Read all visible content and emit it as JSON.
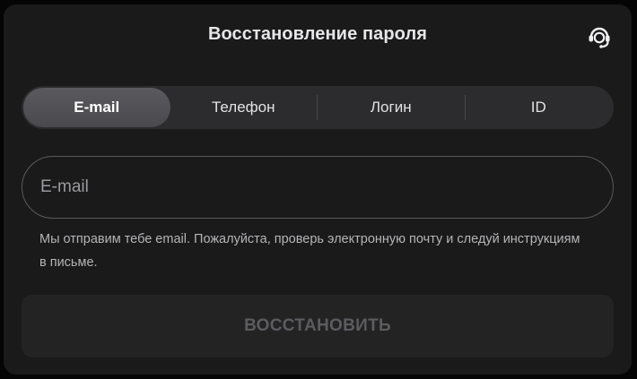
{
  "modal": {
    "title": "Восстановление пароля",
    "support_icon": "headset-support-icon"
  },
  "tabs": [
    {
      "label": "E-mail",
      "active": true
    },
    {
      "label": "Телефон",
      "active": false
    },
    {
      "label": "Логин",
      "active": false
    },
    {
      "label": "ID",
      "active": false
    }
  ],
  "email_field": {
    "value": "",
    "placeholder": "E-mail"
  },
  "hint": "Мы отправим тебе email. Пожалуйста, проверь электронную почту и следуй инструкциям в письме.",
  "submit": {
    "label": "ВОССТАНОВИТЬ",
    "enabled": false
  },
  "colors": {
    "background": "#1a1a1b",
    "tab_active": "#4a4a4e",
    "text": "#e6e6e8",
    "submit_disabled_text": "#5c5c60"
  }
}
